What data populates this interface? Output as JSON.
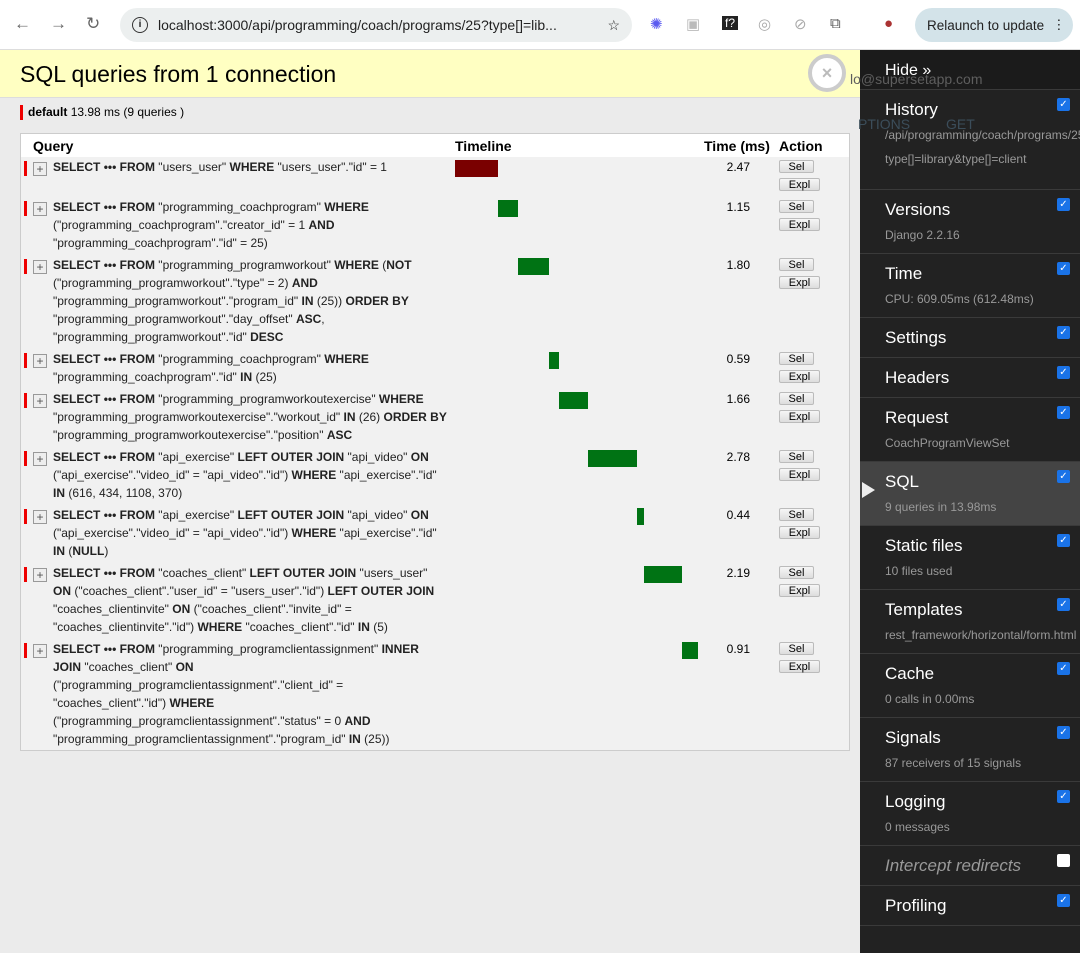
{
  "browser": {
    "url": "localhost:3000/api/programming/coach/programs/25?type[]=lib...",
    "relaunch": "Relaunch to update"
  },
  "panel": {
    "title": "SQL queries from 1 connection",
    "connection_name": "default",
    "connection_stats": "13.98 ms (9 queries )",
    "headers": {
      "query": "Query",
      "timeline": "Timeline",
      "time": "Time (ms)",
      "action": "Action"
    },
    "sel_label": "Sel",
    "expl_label": "Expl",
    "queries": [
      {
        "time": "2.47",
        "color": "#7a0000",
        "lines": [
          "SELECT ••• FROM \"users_user\" WHERE \"users_user\".\"id\" = 1"
        ]
      },
      {
        "time": "1.15",
        "color": "#007314",
        "lines": [
          "SELECT ••• FROM \"programming_coachprogram\" WHERE",
          "(\"programming_coachprogram\".\"creator_id\" = 1 AND",
          "\"programming_coachprogram\".\"id\" = 25)"
        ]
      },
      {
        "time": "1.80",
        "color": "#007314",
        "lines": [
          "SELECT ••• FROM \"programming_programworkout\" WHERE (NOT",
          "(\"programming_programworkout\".\"type\" = 2) AND",
          "\"programming_programworkout\".\"program_id\" IN (25)) ORDER BY",
          "\"programming_programworkout\".\"day_offset\" ASC,",
          "\"programming_programworkout\".\"id\" DESC"
        ]
      },
      {
        "time": "0.59",
        "color": "#007314",
        "lines": [
          "SELECT ••• FROM \"programming_coachprogram\" WHERE",
          "\"programming_coachprogram\".\"id\" IN (25)"
        ]
      },
      {
        "time": "1.66",
        "color": "#007314",
        "lines": [
          "SELECT ••• FROM \"programming_programworkoutexercise\" WHERE",
          "\"programming_programworkoutexercise\".\"workout_id\" IN (26) ORDER BY",
          "\"programming_programworkoutexercise\".\"position\" ASC"
        ]
      },
      {
        "time": "2.78",
        "color": "#007314",
        "lines": [
          "SELECT ••• FROM \"api_exercise\" LEFT OUTER JOIN \"api_video\" ON",
          "(\"api_exercise\".\"video_id\" = \"api_video\".\"id\") WHERE \"api_exercise\".\"id\"",
          "IN (616, 434, 1108, 370)"
        ]
      },
      {
        "time": "0.44",
        "color": "#007314",
        "lines": [
          "SELECT ••• FROM \"api_exercise\" LEFT OUTER JOIN \"api_video\" ON",
          "(\"api_exercise\".\"video_id\" = \"api_video\".\"id\") WHERE \"api_exercise\".\"id\"",
          "IN (NULL)"
        ]
      },
      {
        "time": "2.19",
        "color": "#007314",
        "lines": [
          "SELECT ••• FROM \"coaches_client\" LEFT OUTER JOIN \"users_user\"",
          "ON (\"coaches_client\".\"user_id\" = \"users_user\".\"id\") LEFT OUTER JOIN",
          "\"coaches_clientinvite\" ON (\"coaches_client\".\"invite_id\" =",
          "\"coaches_clientinvite\".\"id\") WHERE \"coaches_client\".\"id\" IN (5)"
        ]
      },
      {
        "time": "0.91",
        "color": "#007314",
        "lines": [
          "SELECT ••• FROM \"programming_programclientassignment\" INNER",
          "JOIN \"coaches_client\" ON",
          "(\"programming_programclientassignment\".\"client_id\" =",
          "\"coaches_client\".\"id\") WHERE",
          "(\"programming_programclientassignment\".\"status\" = 0 AND",
          "\"programming_programclientassignment\".\"program_id\" IN (25))"
        ]
      }
    ]
  },
  "toolbar": {
    "hide": "Hide »",
    "items": [
      {
        "title": "History",
        "sub": "/api/programming/coach/programs/25",
        "sub2": "type[]=library&type[]=client",
        "checked": true
      },
      {
        "title": "Versions",
        "sub": "Django 2.2.16",
        "checked": true
      },
      {
        "title": "Time",
        "sub": "CPU: 609.05ms (612.48ms)",
        "checked": true
      },
      {
        "title": "Settings",
        "checked": true
      },
      {
        "title": "Headers",
        "checked": true
      },
      {
        "title": "Request",
        "sub": "CoachProgramViewSet",
        "checked": true
      },
      {
        "title": "SQL",
        "sub": "9 queries in 13.98ms",
        "checked": true,
        "active": true
      },
      {
        "title": "Static files",
        "sub": "10 files used",
        "checked": true
      },
      {
        "title": "Templates",
        "sub": "rest_framework/horizontal/form.html",
        "checked": true
      },
      {
        "title": "Cache",
        "sub": "0 calls in 0.00ms",
        "checked": true
      },
      {
        "title": "Signals",
        "sub": "87 receivers of 15 signals",
        "checked": true
      },
      {
        "title": "Logging",
        "sub": "0 messages",
        "checked": true
      },
      {
        "title": "Intercept redirects",
        "checked": false,
        "italic": true
      },
      {
        "title": "Profiling",
        "checked": true
      }
    ]
  },
  "background_page": {
    "email": "lo@supersetapp.com",
    "options": "PTIONS",
    "get": "GET"
  }
}
